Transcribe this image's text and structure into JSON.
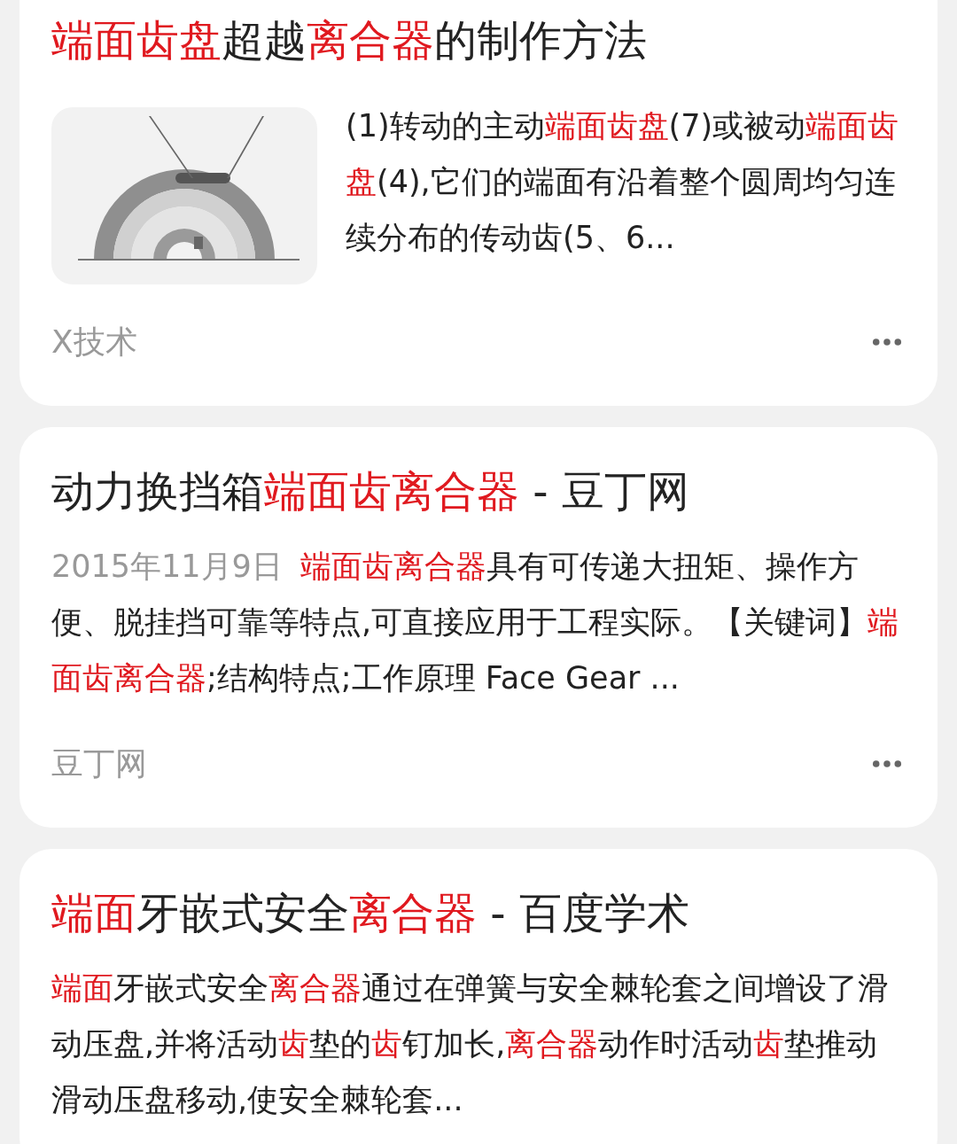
{
  "results": [
    {
      "title": [
        {
          "text": "端面齿盘",
          "highlight": true
        },
        {
          "text": "超越",
          "highlight": false
        },
        {
          "text": "离合器",
          "highlight": true
        },
        {
          "text": "的制作方法",
          "highlight": false
        }
      ],
      "thumbnail": {
        "kind": "picture"
      },
      "snippet": [
        {
          "text": "(1)转动的主动",
          "highlight": false
        },
        {
          "text": "端面齿盘",
          "highlight": true
        },
        {
          "text": "(7)或被动",
          "highlight": false
        },
        {
          "text": "端面齿盘",
          "highlight": true
        },
        {
          "text": "(4),它们的端面有沿着整个圆周均匀连续分布的传动齿(5、6...",
          "highlight": false
        }
      ],
      "source": "X技术"
    },
    {
      "title": [
        {
          "text": "动力换挡箱",
          "highlight": false
        },
        {
          "text": "端面齿离合器",
          "highlight": true
        },
        {
          "text": " - 豆丁网",
          "highlight": false
        }
      ],
      "date": "2015年11月9日",
      "snippet": [
        {
          "text": "端面齿离合器",
          "highlight": true
        },
        {
          "text": "具有可传递大扭矩、操作方便、脱挂挡可靠等特点,可直接应用于工程实际。【关键词】",
          "highlight": false
        },
        {
          "text": "端面齿离合器",
          "highlight": true
        },
        {
          "text": ";结构特点;工作原理 Face Gear ...",
          "highlight": false
        }
      ],
      "source": "豆丁网"
    },
    {
      "title": [
        {
          "text": "端面",
          "highlight": true
        },
        {
          "text": "牙嵌式安全",
          "highlight": false
        },
        {
          "text": "离合器",
          "highlight": true
        },
        {
          "text": " - 百度学术",
          "highlight": false
        }
      ],
      "snippet": [
        {
          "text": "端面",
          "highlight": true
        },
        {
          "text": "牙嵌式安全",
          "highlight": false
        },
        {
          "text": "离合器",
          "highlight": true
        },
        {
          "text": "通过在弹簧与安全棘轮套之间增设了滑动压盘,并将活动",
          "highlight": false
        },
        {
          "text": "齿",
          "highlight": true
        },
        {
          "text": "垫的",
          "highlight": false
        },
        {
          "text": "齿",
          "highlight": true
        },
        {
          "text": "钉加长,",
          "highlight": false
        },
        {
          "text": "离合器",
          "highlight": true
        },
        {
          "text": "动作时活动",
          "highlight": false
        },
        {
          "text": "齿",
          "highlight": true
        },
        {
          "text": "垫推动滑动压盘移动,使安全棘轮套...",
          "highlight": false
        }
      ]
    }
  ]
}
